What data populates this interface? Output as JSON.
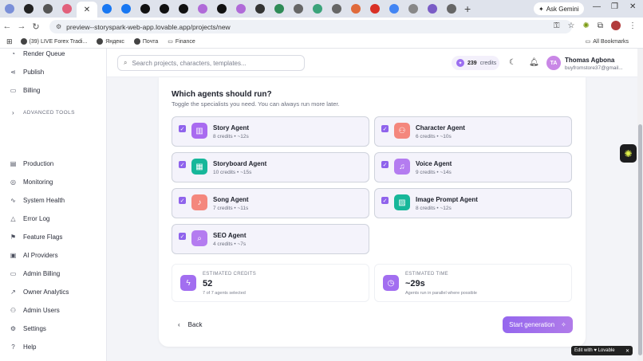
{
  "browser": {
    "tabs": [
      {
        "icon": "settings-tab-icon",
        "color": "#7a8fd8"
      },
      {
        "icon": "github-tab-icon",
        "color": "#222222"
      },
      {
        "icon": "settings-tab-icon",
        "color": "#555555"
      },
      {
        "icon": "lovable-tab-icon",
        "color": "#e2607b"
      },
      {
        "icon": "meta-tab-icon",
        "color": "#1877f2"
      },
      {
        "icon": "facebook-tab-icon",
        "color": "#1877f2"
      },
      {
        "icon": "threads-tab-icon",
        "color": "#111111"
      },
      {
        "icon": "threads-tab-icon",
        "color": "#111111"
      },
      {
        "icon": "threads-tab-icon",
        "color": "#111111"
      },
      {
        "icon": "chatgpt-tab-icon",
        "color": "#b06ad8"
      },
      {
        "icon": "threads-tab-icon",
        "color": "#111111"
      },
      {
        "icon": "chatgpt-tab-icon",
        "color": "#b06ad8"
      },
      {
        "icon": "openai-tab-icon",
        "color": "#333333"
      },
      {
        "icon": "arrow-tab-icon",
        "color": "#2e8b57"
      },
      {
        "icon": "settings-tab-icon",
        "color": "#666666"
      },
      {
        "icon": "openai-tab-icon",
        "color": "#3aa37a"
      },
      {
        "icon": "settings-tab-icon",
        "color": "#666666"
      },
      {
        "icon": "brand-tab-icon",
        "color": "#e06a3a"
      },
      {
        "icon": "gmail-tab-icon",
        "color": "#d93025"
      },
      {
        "icon": "chrome-tab-icon",
        "color": "#4285f4"
      },
      {
        "icon": "openai-tab-icon",
        "color": "#888888"
      },
      {
        "icon": "chatgpt-tab-icon",
        "color": "#7a5cc6"
      },
      {
        "icon": "settings-tab-icon",
        "color": "#666666"
      }
    ],
    "ask_gemini": "Ask Gemini",
    "url": "preview--storyspark-web-app.lovable.app/projects/new",
    "bookmarks": [
      {
        "label": "(39) LIVE Forex Tradi..."
      },
      {
        "label": "Яндекс"
      },
      {
        "label": "Почта"
      },
      {
        "label": "Finance"
      }
    ],
    "all_bookmarks": "All Bookmarks"
  },
  "sidebar": {
    "top_items": [
      {
        "label": "Render Queue",
        "icon": "render-queue-icon"
      },
      {
        "label": "Publish",
        "icon": "share-icon"
      },
      {
        "label": "Billing",
        "icon": "billing-icon"
      }
    ],
    "advanced_tools": "ADVANCED TOOLS",
    "items": [
      {
        "label": "Production",
        "icon": "production-icon"
      },
      {
        "label": "Monitoring",
        "icon": "monitoring-icon"
      },
      {
        "label": "System Health",
        "icon": "pulse-icon"
      },
      {
        "label": "Error Log",
        "icon": "warning-icon"
      },
      {
        "label": "Feature Flags",
        "icon": "flag-icon"
      },
      {
        "label": "AI Providers",
        "icon": "cpu-icon"
      },
      {
        "label": "Admin Billing",
        "icon": "billing-icon"
      },
      {
        "label": "Owner Analytics",
        "icon": "chart-icon"
      },
      {
        "label": "Admin Users",
        "icon": "users-icon"
      },
      {
        "label": "Settings",
        "icon": "gear-icon"
      },
      {
        "label": "Help",
        "icon": "help-icon"
      }
    ]
  },
  "header": {
    "search_placeholder": "Search projects, characters, templates...",
    "credits_value": "239",
    "credits_label": "credits",
    "user_initials": "TA",
    "user_name": "Thomas Agbona",
    "user_email": "buyfromstore37@gmail..."
  },
  "main": {
    "title": "Which agents should run?",
    "subtitle": "Toggle the specialists you need. You can always run more later.",
    "agents": [
      {
        "name": "Story Agent",
        "meta": "8 credits • ~12s",
        "icon": "book-icon",
        "color": "#a96bf0",
        "checked": true
      },
      {
        "name": "Character Agent",
        "meta": "6 credits • ~10s",
        "icon": "users-icon",
        "color": "#f4877d",
        "checked": true
      },
      {
        "name": "Storyboard Agent",
        "meta": "10 credits • ~15s",
        "icon": "film-icon",
        "color": "#17b79a",
        "checked": true
      },
      {
        "name": "Voice Agent",
        "meta": "9 credits • ~14s",
        "icon": "mic-icon",
        "color": "#b47cf0",
        "checked": true
      },
      {
        "name": "Song Agent",
        "meta": "7 credits • ~11s",
        "icon": "music-icon",
        "color": "#f4877d",
        "checked": true
      },
      {
        "name": "Image Prompt Agent",
        "meta": "8 credits • ~12s",
        "icon": "image-icon",
        "color": "#17b79a",
        "checked": true
      },
      {
        "name": "SEO Agent",
        "meta": "4 credits • ~7s",
        "icon": "search-icon",
        "color": "#b47cf0",
        "checked": true
      }
    ],
    "estimated_credits": {
      "label": "ESTIMATED CREDITS",
      "value": "52",
      "note": "7 of 7 agents selected",
      "color": "#a26ef0"
    },
    "estimated_time": {
      "label": "ESTIMATED TIME",
      "value": "~29s",
      "note": "Agents run in parallel where possible",
      "color": "#a26ef0"
    },
    "back_label": "Back",
    "start_label": "Start generation"
  },
  "edit_with_lovable": "Edit with ♥ Lovable"
}
